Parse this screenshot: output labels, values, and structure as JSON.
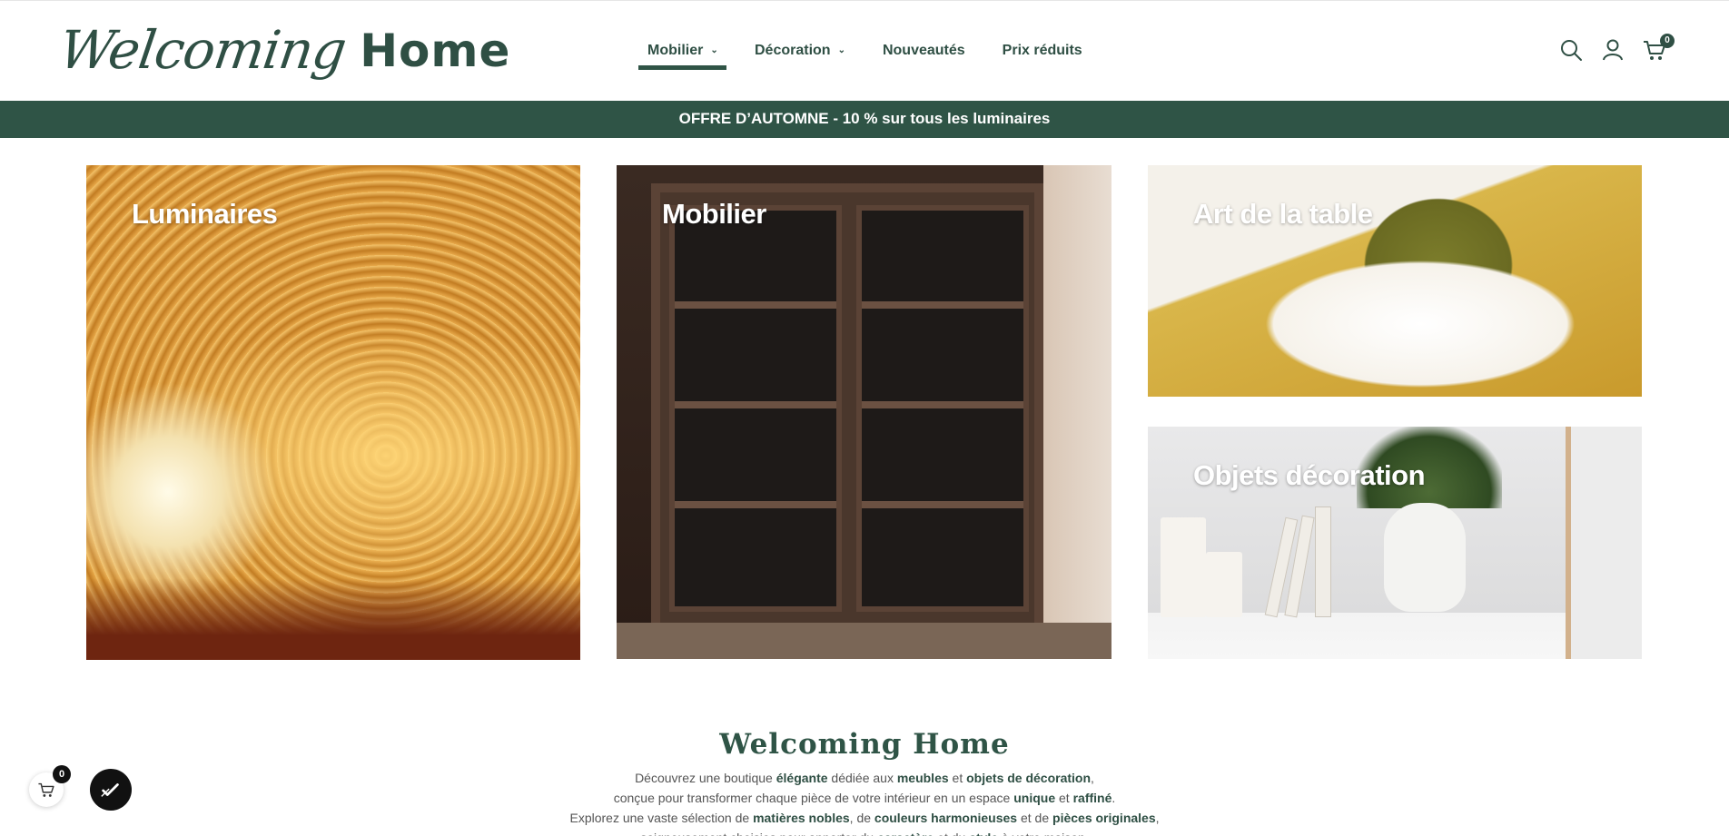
{
  "brand": {
    "logo_script": "Welcoming",
    "logo_bold": "Home"
  },
  "nav": {
    "items": [
      {
        "label": "Mobilier",
        "has_dropdown": true,
        "active": true
      },
      {
        "label": "Décoration",
        "has_dropdown": true,
        "active": false
      },
      {
        "label": "Nouveautés",
        "has_dropdown": false,
        "active": false
      },
      {
        "label": "Prix réduits",
        "has_dropdown": false,
        "active": false
      }
    ],
    "chevron": "⌄"
  },
  "header_icons": {
    "search": "search-icon",
    "account": "user-icon",
    "cart": "cart-icon",
    "cart_count": "0"
  },
  "announcement": {
    "text": "OFFRE D’AUTOMNE - 10 % sur tous les luminaires"
  },
  "categories": [
    {
      "label": "Luminaires"
    },
    {
      "label": "Mobilier"
    },
    {
      "label": "Art de la table"
    },
    {
      "label": "Objets décoration"
    }
  ],
  "about": {
    "title": "Welcoming Home",
    "line1": [
      {
        "t": "Découvrez une boutique ",
        "b": false
      },
      {
        "t": "élégante",
        "b": true
      },
      {
        "t": " dédiée aux ",
        "b": false
      },
      {
        "t": "meubles",
        "b": true
      },
      {
        "t": " et ",
        "b": false
      },
      {
        "t": "objets de décoration",
        "b": true
      },
      {
        "t": ",",
        "b": false
      }
    ],
    "line2": [
      {
        "t": "conçue pour transformer chaque pièce de votre intérieur en un espace ",
        "b": false
      },
      {
        "t": "unique",
        "b": true
      },
      {
        "t": " et ",
        "b": false
      },
      {
        "t": "raffiné",
        "b": true
      },
      {
        "t": ".",
        "b": false
      }
    ],
    "line3": [
      {
        "t": "Explorez une vaste sélection de ",
        "b": false
      },
      {
        "t": "matières nobles",
        "b": true
      },
      {
        "t": ", de ",
        "b": false
      },
      {
        "t": "couleurs harmonieuses",
        "b": true
      },
      {
        "t": " et de ",
        "b": false
      },
      {
        "t": "pièces originales",
        "b": true
      },
      {
        "t": ",",
        "b": false
      }
    ],
    "line4": [
      {
        "t": "soigneusement choisies pour apporter du ",
        "b": false
      },
      {
        "t": "caractère",
        "b": true
      },
      {
        "t": " et du ",
        "b": false
      },
      {
        "t": "style",
        "b": true
      },
      {
        "t": " à votre maison.",
        "b": false
      }
    ]
  },
  "floating": {
    "cart_count": "0",
    "cart_icon": "cart-icon",
    "check_icon": "checkmark-icon"
  },
  "colors": {
    "brand_green": "#2f5446",
    "text_green": "#2f4f44"
  }
}
